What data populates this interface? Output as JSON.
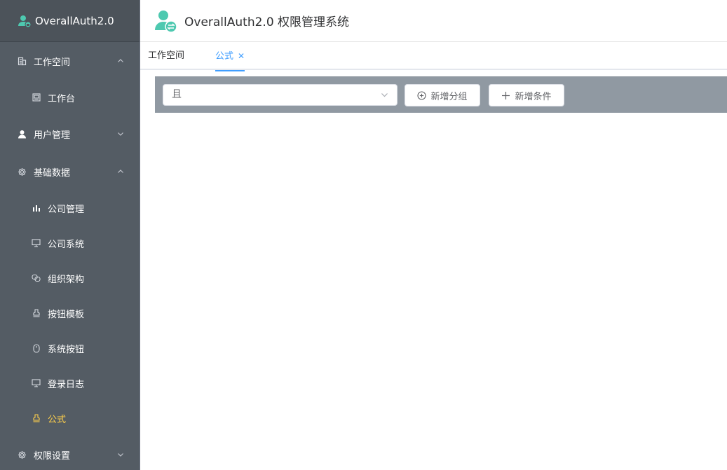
{
  "brand": {
    "title": "OverallAuth2.0",
    "icon": "user-lock-icon"
  },
  "header": {
    "title": "OverallAuth2.0 权限管理系统",
    "icon": "user-exchange-icon"
  },
  "sidebar": {
    "groups": [
      {
        "label": "工作空间",
        "icon": "building-icon",
        "expanded": true,
        "items": [
          {
            "label": "工作台",
            "icon": "picture-icon"
          }
        ]
      },
      {
        "label": "用户管理",
        "icon": "user-icon",
        "expanded": false,
        "items": []
      },
      {
        "label": "基础数据",
        "icon": "gear-icon",
        "expanded": true,
        "items": [
          {
            "label": "公司管理",
            "icon": "bar-chart-icon"
          },
          {
            "label": "公司系统",
            "icon": "monitor-icon"
          },
          {
            "label": "组织架构",
            "icon": "connection-icon"
          },
          {
            "label": "按钮模板",
            "icon": "stamp-icon"
          },
          {
            "label": "系统按钮",
            "icon": "mouse-icon"
          },
          {
            "label": "登录日志",
            "icon": "monitor-icon"
          },
          {
            "label": "公式",
            "icon": "stamp-icon",
            "active": true
          }
        ]
      },
      {
        "label": "权限设置",
        "icon": "gear-icon",
        "expanded": false,
        "items": []
      }
    ]
  },
  "tabs": [
    {
      "label": "工作空间",
      "active": false
    },
    {
      "label": "公式",
      "active": true,
      "closable": true
    }
  ],
  "toolbar": {
    "select_value": "且",
    "add_group_label": "新增分组",
    "add_condition_label": "新增条件"
  },
  "colors": {
    "sidebar_bg": "#545c64",
    "active_menu": "#ffd04b",
    "accent": "#409eff",
    "toolbar_bg": "#9099a2",
    "brand_icon": "#4ec9b0"
  }
}
